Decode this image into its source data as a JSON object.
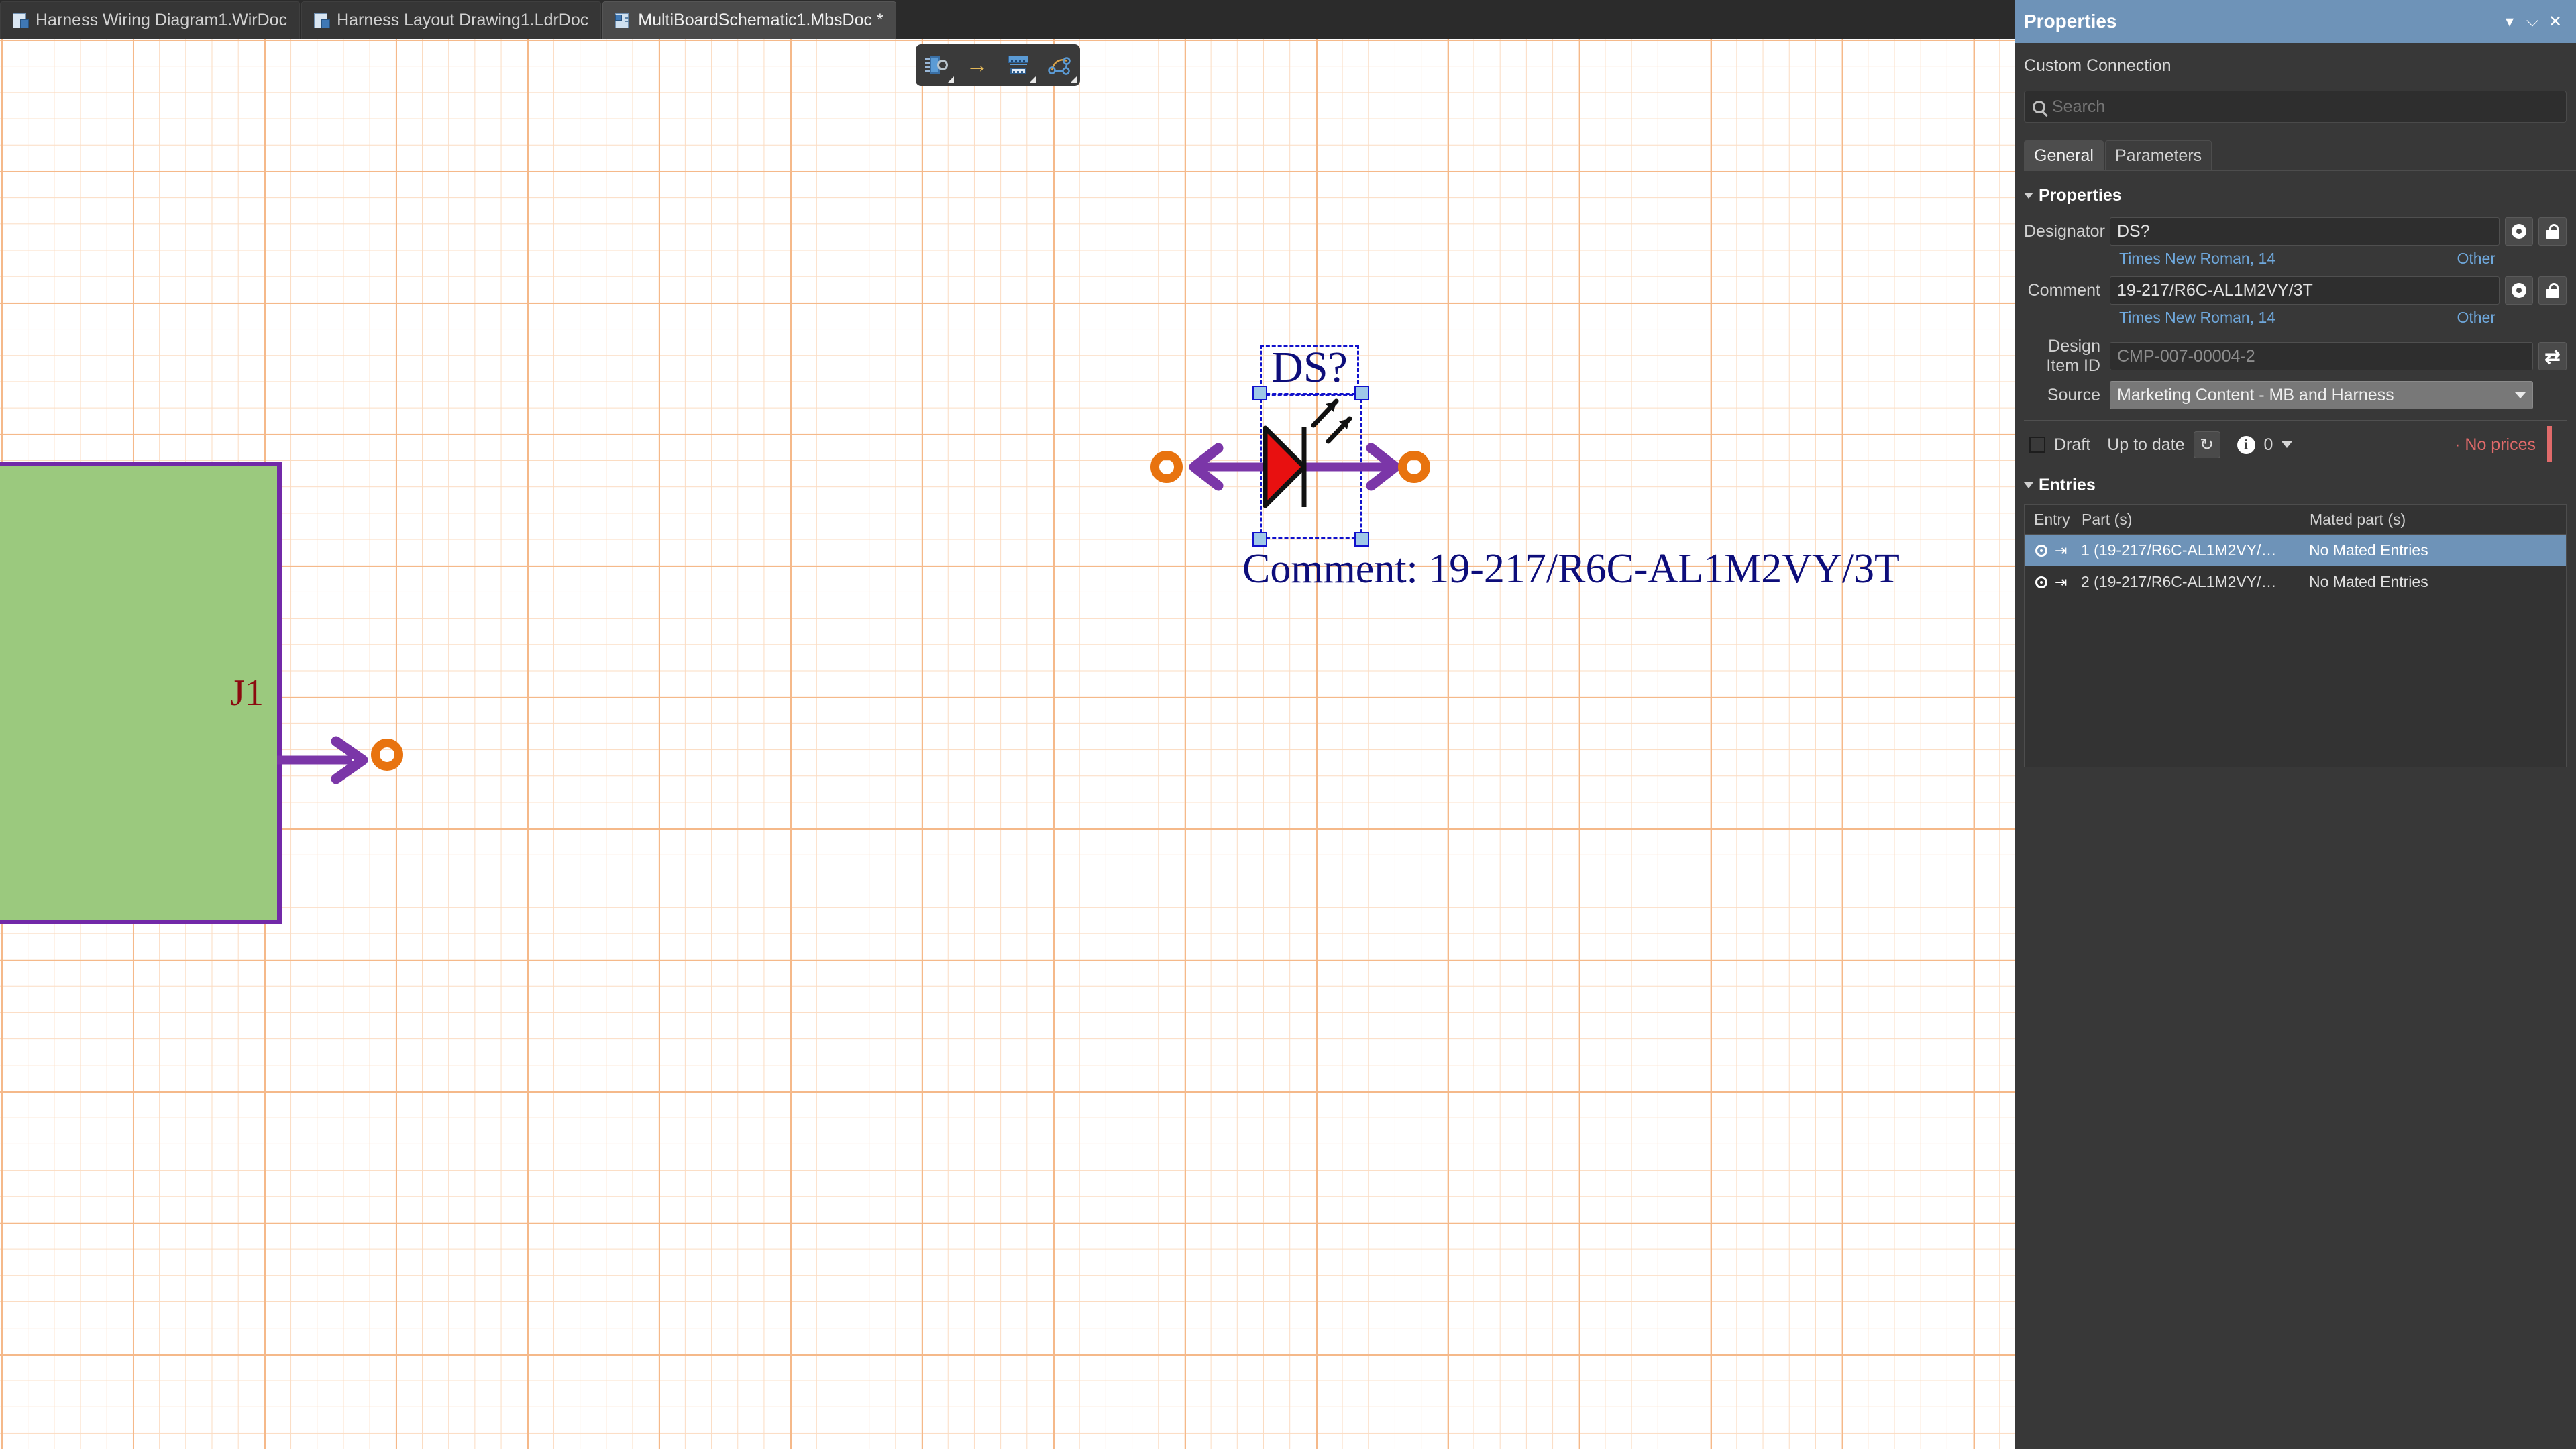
{
  "tabs": [
    {
      "label": "Harness Wiring Diagram1.WirDoc",
      "icon": "wiring-doc-icon",
      "active": false
    },
    {
      "label": "Harness Layout Drawing1.LdrDoc",
      "icon": "layout-doc-icon",
      "active": false
    },
    {
      "label": "MultiBoardSchematic1.MbsDoc *",
      "icon": "schematic-doc-icon",
      "active": true
    }
  ],
  "canvas": {
    "toolbar": [
      {
        "icon": "place-component-icon"
      },
      {
        "icon": "place-arrow-icon"
      },
      {
        "icon": "place-connector-icon"
      },
      {
        "icon": "place-harness-icon"
      }
    ],
    "board": {
      "label": "J1"
    },
    "component": {
      "designator": "DS?",
      "comment": "Comment: 19-217/R6C-AL1M2VY/3T",
      "symbol": "led-diode-symbol"
    },
    "colors": {
      "grid_major": "#f5b98a",
      "grid_minor": "#fbdcc2",
      "board_fill": "#9bc97e",
      "board_border": "#7229a8",
      "pin_arrow": "#7b36a8",
      "terminal": "#e8730f",
      "text_blue": "#0d0d7a",
      "label_red": "#8b0a10",
      "selection": "#1111cc"
    }
  },
  "properties_panel": {
    "title": "Properties",
    "titlebar_buttons": [
      {
        "name": "dropdown",
        "glyph": "▾"
      },
      {
        "name": "pin",
        "glyph": "⌵"
      },
      {
        "name": "close",
        "glyph": "✕"
      }
    ],
    "subtitle": "Custom Connection",
    "search": {
      "placeholder": "Search",
      "value": ""
    },
    "tabs": [
      {
        "label": "General",
        "active": true
      },
      {
        "label": "Parameters",
        "active": false
      }
    ],
    "properties_section": {
      "header": "Properties",
      "designator": {
        "label": "Designator",
        "value": "DS?",
        "font": "Times New Roman, 14",
        "other": "Other"
      },
      "comment": {
        "label": "Comment",
        "value": "19-217/R6C-AL1M2VY/3T",
        "font": "Times New Roman, 14",
        "other": "Other"
      },
      "design_item_id": {
        "label": "Design Item ID",
        "value": "CMP-007-00004-2"
      },
      "source": {
        "label": "Source",
        "value": "Marketing Content - MB and Harness"
      },
      "status": {
        "draft_label": "Draft",
        "draft_checked": false,
        "up_to_date_label": "Up to date",
        "info_count": "0",
        "prices": "· No prices",
        "prices_color": "#e06a6a"
      }
    },
    "entries_section": {
      "header": "Entries",
      "columns": [
        "Entry",
        "Part (s)",
        "Mated part (s)"
      ],
      "rows": [
        {
          "entry": "1",
          "part": "1 (19-217/R6C-AL1M2VY/…",
          "mated": "No Mated Entries",
          "selected": true
        },
        {
          "entry": "2",
          "part": "2 (19-217/R6C-AL1M2VY/…",
          "mated": "No Mated Entries",
          "selected": false
        }
      ]
    }
  }
}
